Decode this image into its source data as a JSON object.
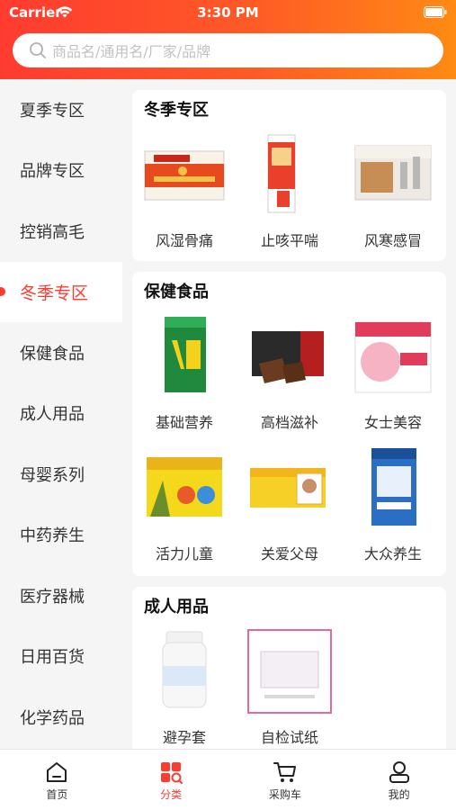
{
  "status": {
    "carrier": "Carrier",
    "time": "3:30 PM"
  },
  "search": {
    "placeholder": "商品名/通用名/厂家/品牌"
  },
  "sidebar": {
    "items": [
      "夏季专区",
      "品牌专区",
      "控销高毛",
      "冬季专区",
      "保健食品",
      "成人用品",
      "母婴系列",
      "中药养生",
      "医疗器械",
      "日用百货",
      "化学药品"
    ],
    "active_index": 3
  },
  "sections": [
    {
      "title": "冬季专区",
      "products": [
        "风湿骨痛",
        "止咳平喘",
        "风寒感冒"
      ]
    },
    {
      "title": "保健食品",
      "products": [
        "基础营养",
        "高档滋补",
        "女士美容",
        "活力儿童",
        "关爱父母",
        "大众养生"
      ]
    },
    {
      "title": "成人用品",
      "products": [
        "避孕套",
        "自检试纸"
      ]
    }
  ],
  "tabbar": {
    "tabs": [
      "首页",
      "分类",
      "采购车",
      "我的"
    ],
    "active_index": 1
  },
  "colors": {
    "accent": "#ff3b30",
    "header_start": "#ff3b30",
    "header_end": "#ff8a14"
  }
}
